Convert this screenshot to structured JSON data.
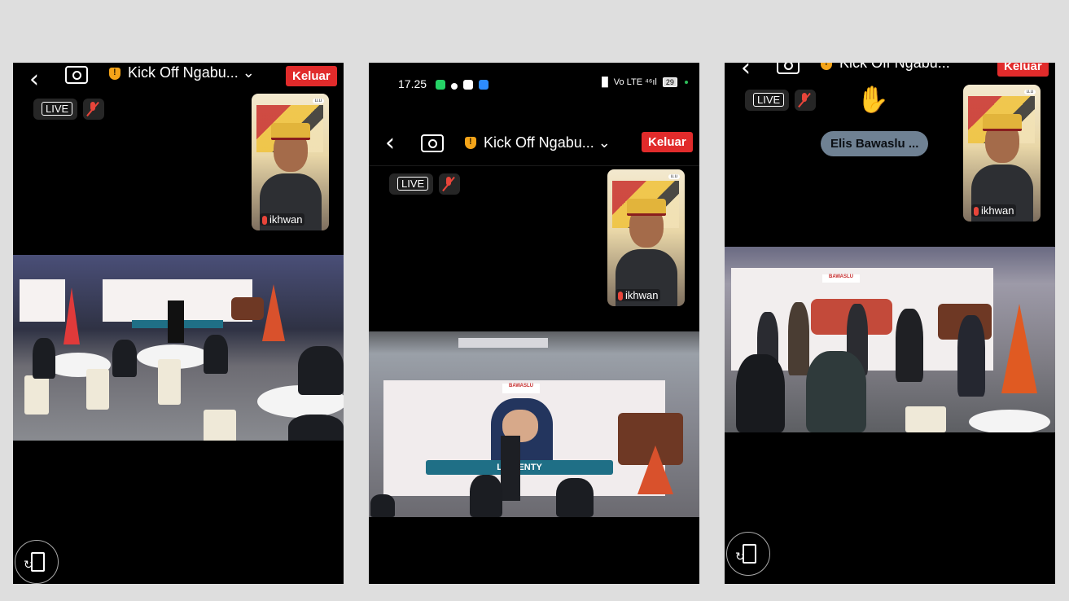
{
  "phones": [
    {
      "meeting_title": "Kick Off Ngabu...",
      "leave_label": "Keluar",
      "live_label": "LIVE",
      "participant": {
        "name": "ikhwan"
      }
    },
    {
      "status_bar": {
        "time": "17.25",
        "signal_text": "Vo LTE ⁴⁶ıl",
        "battery": "29"
      },
      "meeting_title": "Kick Off Ngabu...",
      "leave_label": "Keluar",
      "live_label": "LIVE",
      "participant": {
        "name": "ikhwan"
      },
      "screen_banner": "LOU  ENTY"
    },
    {
      "meeting_title": "Kick Off Ngabu...",
      "leave_label": "Keluar",
      "live_label": "LIVE",
      "participant": {
        "name": "ikhwan"
      },
      "speaker_pill": "Elis Bawaslu ...",
      "reaction": "clapping-hands"
    }
  ],
  "icons": {
    "back": "chevron-left-icon",
    "switch_camera": "camera-switch-icon",
    "security": "shield-icon",
    "dropdown": "chevron-down-icon",
    "mute": "mic-muted-icon",
    "rotate": "rotate-screen-icon"
  },
  "colors": {
    "leave": "#e12b2b",
    "mute": "#e8453a",
    "background": "#dedede"
  }
}
